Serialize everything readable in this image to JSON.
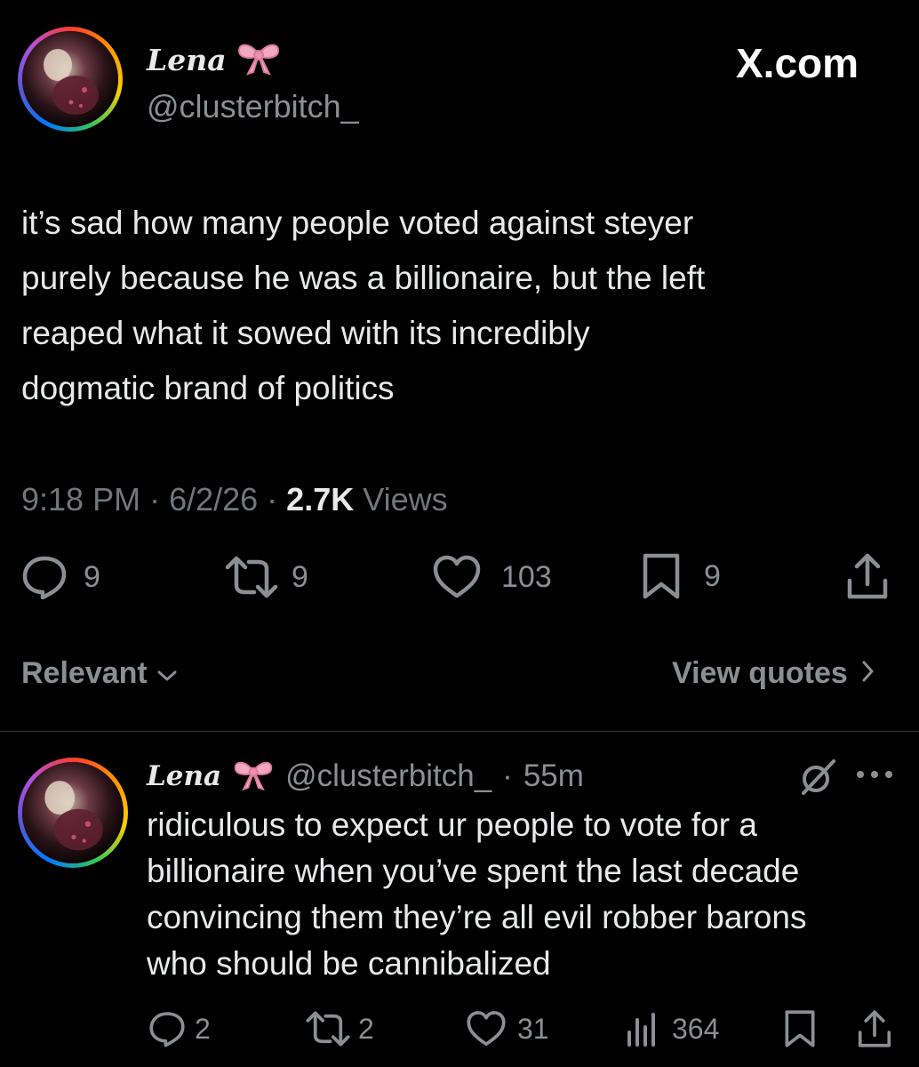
{
  "main_post": {
    "display_name": "Lena",
    "emoji": "🎀",
    "handle": "@clusterbitch_",
    "brand": "X.com",
    "text": "it’s sad how many people voted against steyer\npurely because he was a billionaire, but the left\nreaped what it sowed with its incredibly\ndogmatic brand of politics",
    "time": "9:18 PM",
    "date": "6/2/26",
    "views_count": "2.7K",
    "views_label": "Views",
    "separator": "·",
    "replies": "9",
    "reposts": "9",
    "likes": "103",
    "bookmarks": "9"
  },
  "controls": {
    "sort_label": "Relevant",
    "view_quotes_label": "View quotes"
  },
  "reply": {
    "display_name": "Lena",
    "emoji": "🎀",
    "handle": "@clusterbitch_",
    "separator": "·",
    "age": "55m",
    "text": "ridiculous to expect ur people to vote for a\nbillionaire when you’ve spent the last decade\nconvincing them they’re all evil robber barons\nwho should be cannibalized",
    "replies": "2",
    "reposts": "2",
    "likes": "31",
    "views": "364"
  },
  "icons": {
    "reply": "speech-bubble-icon",
    "repost": "repost-arrows-icon",
    "like": "heart-icon",
    "bookmark": "bookmark-icon",
    "share": "share-upload-icon",
    "views": "bar-chart-icon",
    "grok": "slashed-circle-icon",
    "more": "more-dots-icon",
    "chevron_down": "chevron-down-icon",
    "chevron_right": "chevron-right-icon"
  },
  "colors": {
    "background": "#000000",
    "text": "#e7e9ea",
    "muted": "#71767b",
    "divider": "#2f3336",
    "bow": "#f4a7c0"
  }
}
